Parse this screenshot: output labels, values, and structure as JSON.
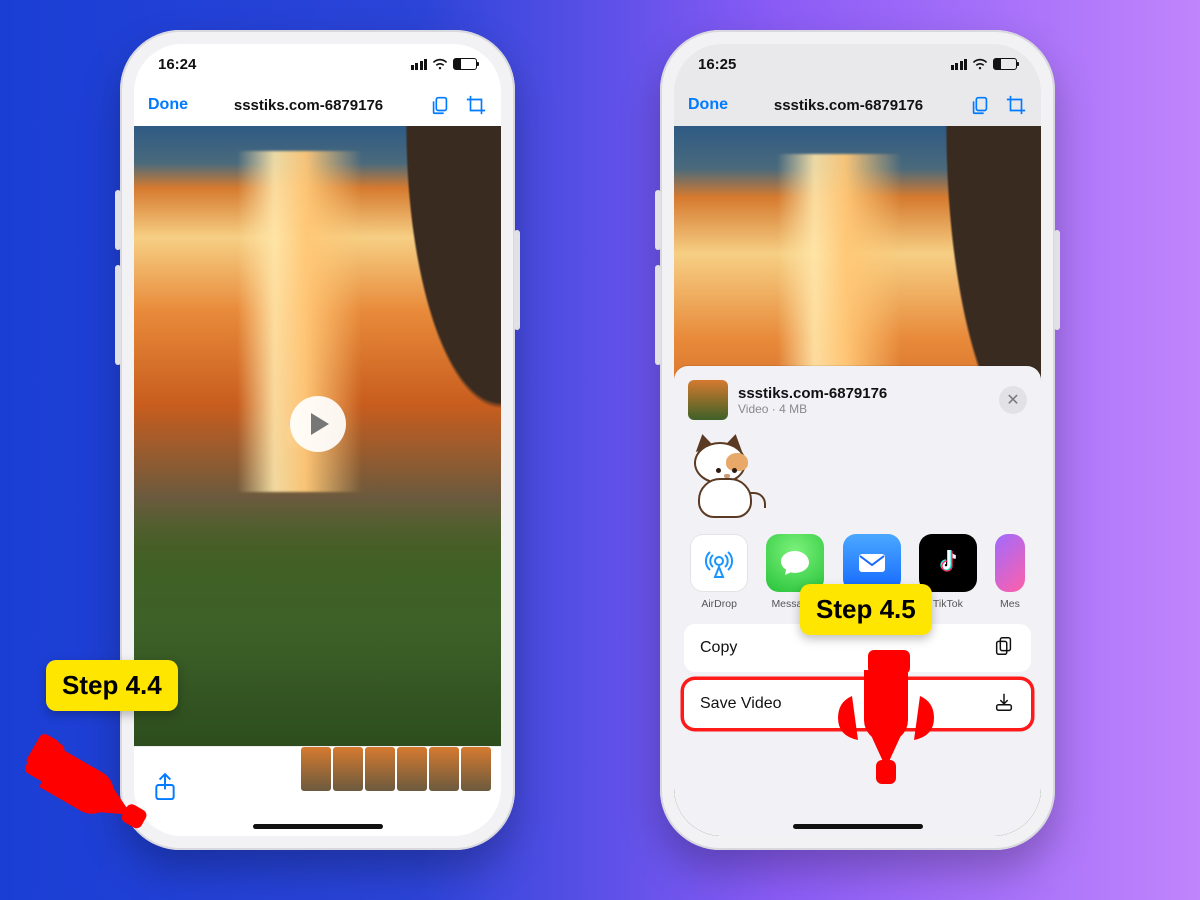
{
  "phone_left": {
    "status_time": "16:24",
    "nav": {
      "done": "Done",
      "title": "ssstiks.com-6879176"
    }
  },
  "phone_right": {
    "status_time": "16:25",
    "nav": {
      "done": "Done",
      "title": "ssstiks.com-6879176"
    },
    "sheet": {
      "title": "ssstiks.com-6879176",
      "subtitle": "Video · 4 MB",
      "apps": [
        {
          "label": "AirDrop"
        },
        {
          "label": "Messages"
        },
        {
          "label": "Mail"
        },
        {
          "label": "TikTok"
        },
        {
          "label": "Messenger"
        }
      ],
      "actions": {
        "copy": "Copy",
        "save_video": "Save Video"
      }
    }
  },
  "annotations": {
    "step_left": "Step 4.4",
    "step_right": "Step 4.5"
  }
}
